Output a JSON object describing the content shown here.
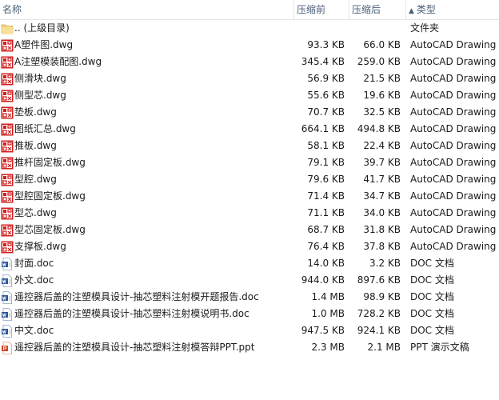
{
  "columns": {
    "name": "名称",
    "before": "压缩前",
    "after": "压缩后",
    "type": "类型",
    "sort_arrow": "▲"
  },
  "colors": {
    "header_text": "#4c607a",
    "dwg_icon": "#d21f1f",
    "doc_icon": "#2b5797",
    "ppt_icon": "#d24726",
    "folder_icon": "#f3d27a"
  },
  "rows": [
    {
      "icon": "folder-icon",
      "name": ".. (上级目录)",
      "before": "",
      "after": "",
      "type": "文件夹"
    },
    {
      "icon": "dwg-file-icon",
      "name": "A塑件图.dwg",
      "before": "93.3 KB",
      "after": "66.0 KB",
      "type": "AutoCAD Drawing"
    },
    {
      "icon": "dwg-file-icon",
      "name": "A注塑模装配图.dwg",
      "before": "345.4 KB",
      "after": "259.0 KB",
      "type": "AutoCAD Drawing"
    },
    {
      "icon": "dwg-file-icon",
      "name": "侧滑块.dwg",
      "before": "56.9 KB",
      "after": "21.5 KB",
      "type": "AutoCAD Drawing"
    },
    {
      "icon": "dwg-file-icon",
      "name": "侧型芯.dwg",
      "before": "55.6 KB",
      "after": "19.6 KB",
      "type": "AutoCAD Drawing"
    },
    {
      "icon": "dwg-file-icon",
      "name": "垫板.dwg",
      "before": "70.7 KB",
      "after": "32.5 KB",
      "type": "AutoCAD Drawing"
    },
    {
      "icon": "dwg-file-icon",
      "name": "图纸汇总.dwg",
      "before": "664.1 KB",
      "after": "494.8 KB",
      "type": "AutoCAD Drawing"
    },
    {
      "icon": "dwg-file-icon",
      "name": "推板.dwg",
      "before": "58.1 KB",
      "after": "22.4 KB",
      "type": "AutoCAD Drawing"
    },
    {
      "icon": "dwg-file-icon",
      "name": "推杆固定板.dwg",
      "before": "79.1 KB",
      "after": "39.7 KB",
      "type": "AutoCAD Drawing"
    },
    {
      "icon": "dwg-file-icon",
      "name": "型腔.dwg",
      "before": "79.6 KB",
      "after": "41.7 KB",
      "type": "AutoCAD Drawing"
    },
    {
      "icon": "dwg-file-icon",
      "name": "型腔固定板.dwg",
      "before": "71.4 KB",
      "after": "34.7 KB",
      "type": "AutoCAD Drawing"
    },
    {
      "icon": "dwg-file-icon",
      "name": "型芯.dwg",
      "before": "71.1 KB",
      "after": "34.0 KB",
      "type": "AutoCAD Drawing"
    },
    {
      "icon": "dwg-file-icon",
      "name": "型芯固定板.dwg",
      "before": "68.7 KB",
      "after": "31.8 KB",
      "type": "AutoCAD Drawing"
    },
    {
      "icon": "dwg-file-icon",
      "name": "支撑板.dwg",
      "before": "76.4 KB",
      "after": "37.8 KB",
      "type": "AutoCAD Drawing"
    },
    {
      "icon": "doc-file-icon",
      "name": "封面.doc",
      "before": "14.0 KB",
      "after": "3.2 KB",
      "type": "DOC 文档"
    },
    {
      "icon": "doc-file-icon",
      "name": "外文.doc",
      "before": "944.0 KB",
      "after": "897.6 KB",
      "type": "DOC 文档"
    },
    {
      "icon": "doc-file-icon",
      "name": "遥控器后盖的注塑模具设计-抽芯塑料注射模开题报告.doc",
      "before": "1.4 MB",
      "after": "98.9 KB",
      "type": "DOC 文档"
    },
    {
      "icon": "doc-file-icon",
      "name": "遥控器后盖的注塑模具设计-抽芯塑料注射模说明书.doc",
      "before": "1.0 MB",
      "after": "728.2 KB",
      "type": "DOC 文档"
    },
    {
      "icon": "doc-file-icon",
      "name": "中文.doc",
      "before": "947.5 KB",
      "after": "924.1 KB",
      "type": "DOC 文档"
    },
    {
      "icon": "ppt-file-icon",
      "name": "遥控器后盖的注塑模具设计-抽芯塑料注射模答辩PPT.ppt",
      "before": "2.3 MB",
      "after": "2.1 MB",
      "type": "PPT 演示文稿"
    }
  ]
}
